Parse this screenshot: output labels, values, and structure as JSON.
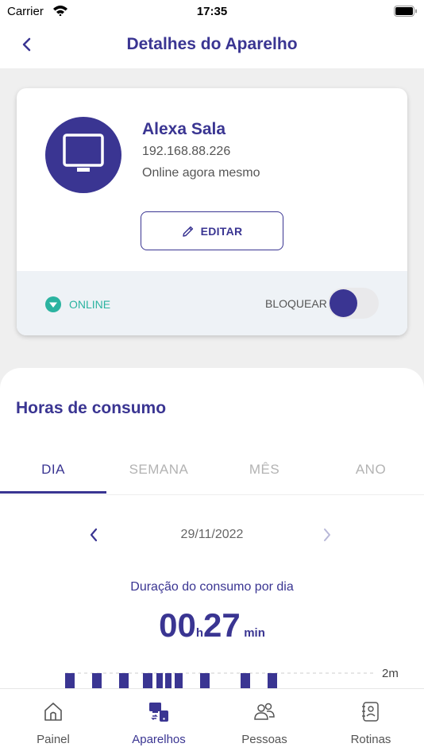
{
  "status_bar": {
    "carrier": "Carrier",
    "time": "17:35"
  },
  "nav": {
    "title": "Detalhes do Aparelho",
    "back_icon": "chevron-left-icon"
  },
  "device": {
    "name": "Alexa Sala",
    "ip": "192.168.88.226",
    "status": "Online agora mesmo",
    "icon": "monitor-icon",
    "edit_label": "EDITAR",
    "online_label": "ONLINE",
    "block_label": "BLOQUEAR",
    "block_enabled": true
  },
  "consumption": {
    "title": "Horas de consumo",
    "tabs": [
      "DIA",
      "SEMANA",
      "MÊS",
      "ANO"
    ],
    "active_tab": 0,
    "date": "29/11/2022",
    "duration_label": "Duração do consumo por dia",
    "hours": "00",
    "hours_unit": "h",
    "minutes": "27",
    "minutes_unit": "min",
    "axis_label": "2m"
  },
  "tabbar": {
    "items": [
      {
        "label": "Painel",
        "icon": "home-icon"
      },
      {
        "label": "Aparelhos",
        "icon": "devices-icon"
      },
      {
        "label": "Pessoas",
        "icon": "people-icon"
      },
      {
        "label": "Rotinas",
        "icon": "routines-icon"
      }
    ],
    "active": 1
  },
  "colors": {
    "primary": "#3a3592",
    "online": "#2bb3a0"
  }
}
